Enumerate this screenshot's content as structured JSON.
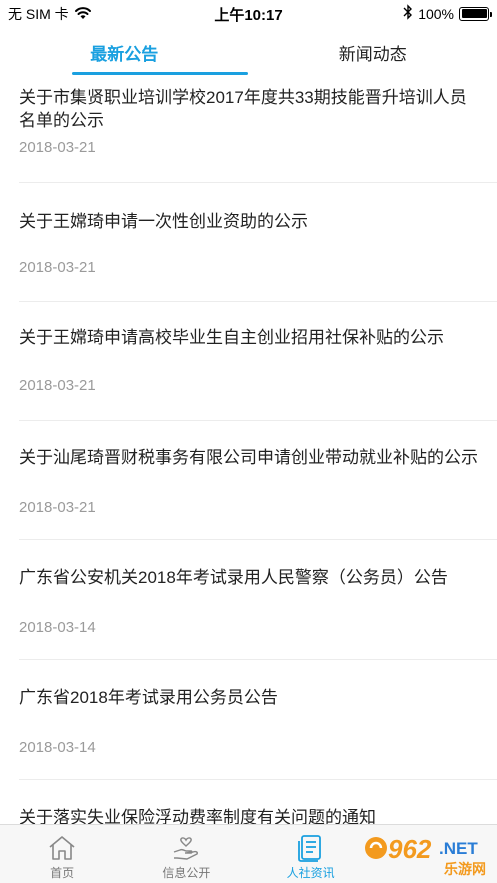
{
  "status_bar": {
    "carrier": "无 SIM 卡",
    "time": "上午10:17",
    "battery_percent": "100%",
    "battery_level": 1.0
  },
  "tabs": [
    {
      "label": "最新公告",
      "active": true
    },
    {
      "label": "新闻动态",
      "active": false
    }
  ],
  "notices": [
    {
      "title": "关于市集贤职业培训学校2017年度共33期技能晋升培训人员名单的公示",
      "date": "2018-03-21"
    },
    {
      "title": "关于王嫦琦申请一次性创业资助的公示",
      "date": "2018-03-21"
    },
    {
      "title": "关于王嫦琦申请高校毕业生自主创业招用社保补贴的公示",
      "date": "2018-03-21"
    },
    {
      "title": "关于汕尾琦晋财税事务有限公司申请创业带动就业补贴的公示",
      "date": "2018-03-21"
    },
    {
      "title": "广东省公安机关2018年考试录用人民警察（公务员）公告",
      "date": "2018-03-14"
    },
    {
      "title": "广东省2018年考试录用公务员公告",
      "date": "2018-03-14"
    },
    {
      "title": "关于落实失业保险浮动费率制度有关问题的通知",
      "date": ""
    }
  ],
  "bottom_nav": [
    {
      "label": "首页",
      "icon": "home-icon",
      "active": false
    },
    {
      "label": "信息公开",
      "icon": "hand-heart-icon",
      "active": false
    },
    {
      "label": "人社资讯",
      "icon": "document-icon",
      "active": true
    },
    {
      "label": "",
      "icon": "",
      "active": false
    }
  ],
  "watermark": {
    "brand": "962",
    "suffix": ".NET",
    "text": "乐游网"
  },
  "colors": {
    "accent": "#1aa0e0",
    "date": "#9a9a9a",
    "divider": "#ececec",
    "watermark_orange": "#f39a1e"
  }
}
